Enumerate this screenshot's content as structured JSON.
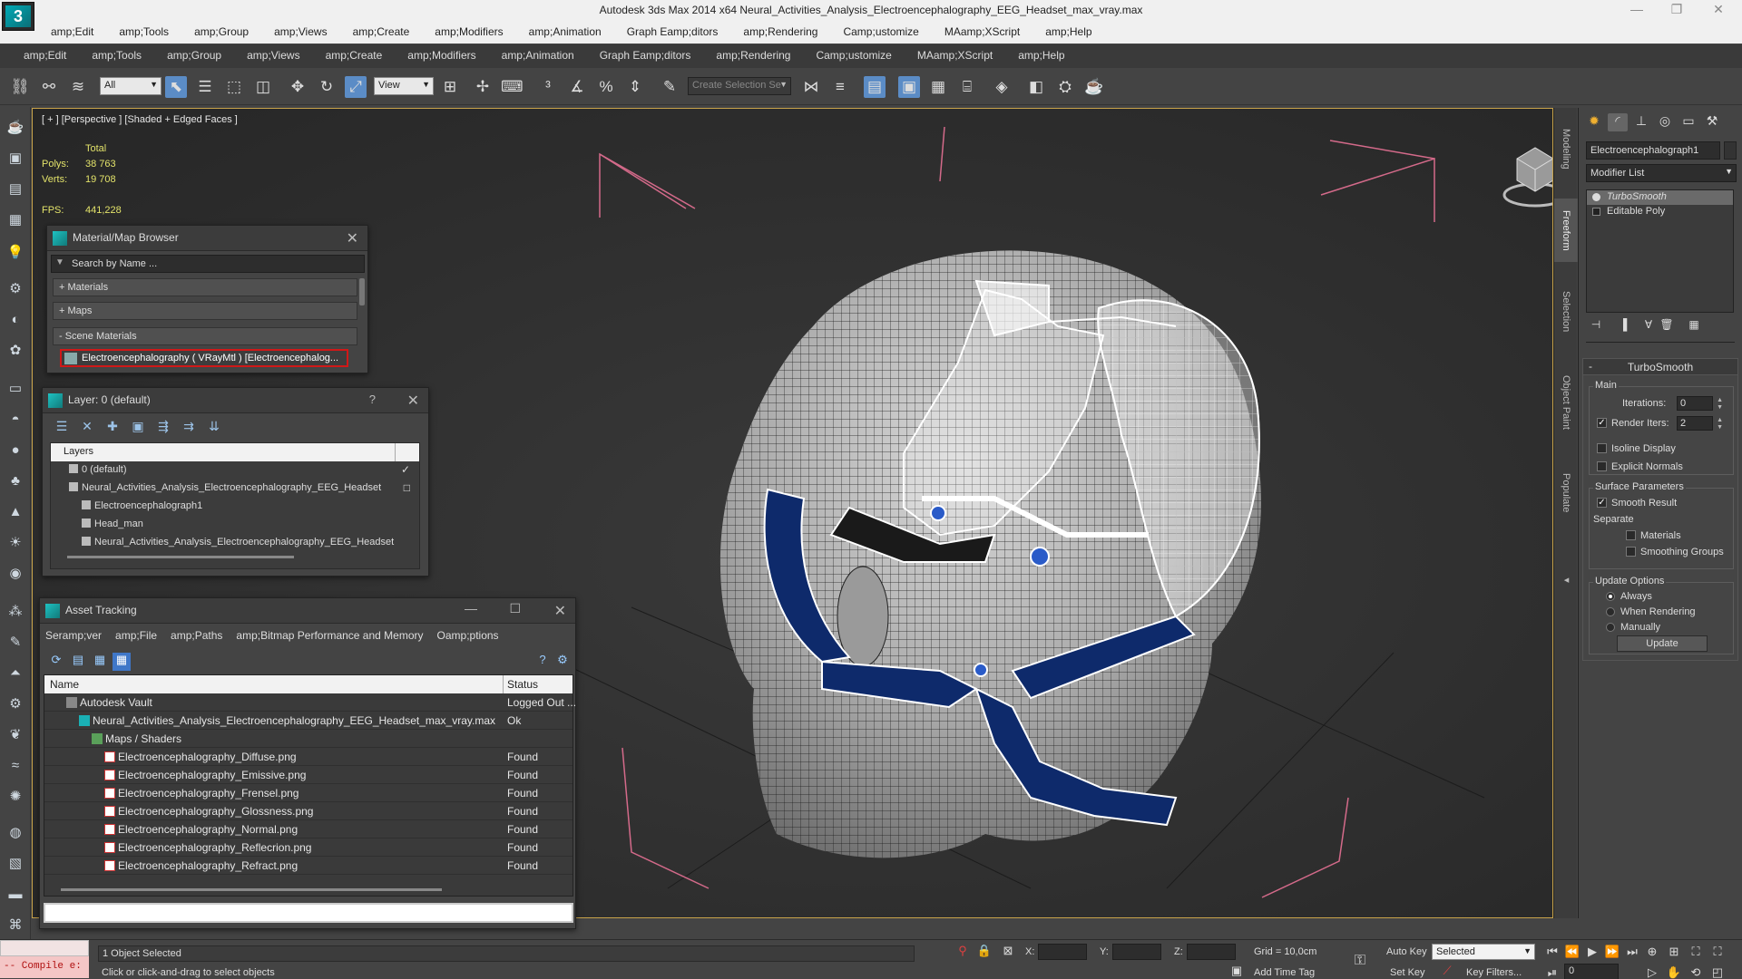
{
  "app": {
    "logo_letter": "3",
    "title": "Autodesk 3ds Max  2014 x64     Neural_Activities_Analysis_Electroencephalography_EEG_Headset_max_vray.max",
    "window_controls": [
      "—",
      "❐",
      "✕"
    ]
  },
  "menu1": [
    "amp;Edit",
    "amp;Tools",
    "amp;Group",
    "amp;Views",
    "amp;Create",
    "amp;Modifiers",
    "amp;Animation",
    "Graph Eamp;ditors",
    "amp;Rendering",
    "Camp;ustomize",
    "MAamp;XScript",
    "amp;Help"
  ],
  "menu2": [
    "amp;Edit",
    "amp;Tools",
    "amp;Group",
    "amp;Views",
    "amp;Create",
    "amp;Modifiers",
    "amp;Animation",
    "Graph Eamp;ditors",
    "amp;Rendering",
    "Camp;ustomize",
    "MAamp;XScript",
    "amp;Help"
  ],
  "toolbar": {
    "selection_filter": "All",
    "ref_coord": "View",
    "named_selection_placeholder": "Create Selection Se",
    "icons": [
      "link-icon",
      "unlink-icon",
      "bind-icon",
      "select-icon",
      "select-by-name-icon",
      "rect-region-icon",
      "window-crossing-icon",
      "move-icon",
      "rotate-icon",
      "scale-icon",
      "pivot-icon",
      "select-manipulate-icon",
      "keyboard-shortcut-icon",
      "snap-icon",
      "angle-snap-icon",
      "percent-snap-icon",
      "spinner-snap-icon",
      "edit-named-sel-icon",
      "mirror-icon",
      "align-icon",
      "layer-explorer-icon",
      "scene-explorer-icon",
      "graphite-icon",
      "curve-editor-icon",
      "schematic-icon",
      "material-editor-icon",
      "render-setup-icon",
      "render-frame-icon",
      "render-icon"
    ]
  },
  "viewport": {
    "label": "[ + ] [Perspective ] [Shaded + Edged Faces ]",
    "stats": {
      "total_label": "Total",
      "polys_label": "Polys:",
      "polys_value": "38 763",
      "verts_label": "Verts:",
      "verts_value": "19 708",
      "fps_label": "FPS:",
      "fps_value": "441,228"
    }
  },
  "material_browser": {
    "title": "Material/Map Browser",
    "search_placeholder": "Search by Name ...",
    "groups": [
      "+ Materials",
      "+ Maps",
      "- Scene Materials"
    ],
    "selected_item": "Electroencephalography  ( VRayMtl ) [Electroencephalog..."
  },
  "layer_panel": {
    "title": "Layer: 0 (default)",
    "help": "?",
    "column": "Layers",
    "rows": [
      {
        "label": "0 (default)",
        "indent": 1,
        "right": "✓"
      },
      {
        "label": "Neural_Activities_Analysis_Electroencephalography_EEG_Headset",
        "indent": 1,
        "right": "□"
      },
      {
        "label": "Electroencephalograph1",
        "indent": 2,
        "right": ""
      },
      {
        "label": "Head_man",
        "indent": 2,
        "right": ""
      },
      {
        "label": "Neural_Activities_Analysis_Electroencephalography_EEG_Headset",
        "indent": 2,
        "right": ""
      }
    ]
  },
  "asset_tracking": {
    "title": "Asset Tracking",
    "menu": [
      "Seramp;ver",
      "amp;File",
      "amp;Paths",
      "amp;Bitmap Performance and Memory",
      "Oamp;ptions"
    ],
    "col_name": "Name",
    "col_status": "Status",
    "rows": [
      {
        "name": "Autodesk Vault",
        "status": "Logged Out ...",
        "indent": 24,
        "icon": "vault"
      },
      {
        "name": "Neural_Activities_Analysis_Electroencephalography_EEG_Headset_max_vray.max",
        "status": "Ok",
        "indent": 38,
        "icon": "max"
      },
      {
        "name": "Maps / Shaders",
        "status": "",
        "indent": 52,
        "icon": "folder"
      },
      {
        "name": "Electroencephalography_Diffuse.png",
        "status": "Found",
        "indent": 66,
        "icon": "png"
      },
      {
        "name": "Electroencephalography_Emissive.png",
        "status": "Found",
        "indent": 66,
        "icon": "png"
      },
      {
        "name": "Electroencephalography_Frensel.png",
        "status": "Found",
        "indent": 66,
        "icon": "png"
      },
      {
        "name": "Electroencephalography_Glossness.png",
        "status": "Found",
        "indent": 66,
        "icon": "png"
      },
      {
        "name": "Electroencephalography_Normal.png",
        "status": "Found",
        "indent": 66,
        "icon": "png"
      },
      {
        "name": "Electroencephalography_Reflecrion.png",
        "status": "Found",
        "indent": 66,
        "icon": "png"
      },
      {
        "name": "Electroencephalography_Refract.png",
        "status": "Found",
        "indent": 66,
        "icon": "png"
      }
    ]
  },
  "vtabs": [
    "Modeling",
    "Freeform",
    "Selection",
    "Object Paint",
    "Populate"
  ],
  "command_panel": {
    "object_name": "Electroencephalograph1",
    "modifier_list": "Modifier List",
    "stack": [
      "TurboSmooth",
      "Editable Poly"
    ],
    "rollout_title": "TurboSmooth",
    "main_label": "Main",
    "iterations_label": "Iterations:",
    "iterations_value": "0",
    "render_iters_label": "Render Iters:",
    "render_iters_value": "2",
    "isoline_label": "Isoline Display",
    "explicit_normals_label": "Explicit Normals",
    "surface_params_label": "Surface Parameters",
    "smooth_result_label": "Smooth Result",
    "separate_label": "Separate",
    "materials_label": "Materials",
    "smoothing_groups_label": "Smoothing Groups",
    "update_options_label": "Update Options",
    "always_label": "Always",
    "when_rendering_label": "When Rendering",
    "manually_label": "Manually",
    "update_button": "Update"
  },
  "status": {
    "compile_text": "-- Compile e:",
    "selection_info": "1 Object Selected",
    "prompt": "Click or click-and-drag to select objects",
    "x_label": "X:",
    "y_label": "Y:",
    "z_label": "Z:",
    "grid": "Grid = 10,0cm",
    "add_time_tag": "Add Time Tag",
    "auto_key": "Auto Key",
    "set_key": "Set Key",
    "key_mode": "Selected",
    "key_filters": "Key Filters...",
    "frame": "0"
  }
}
